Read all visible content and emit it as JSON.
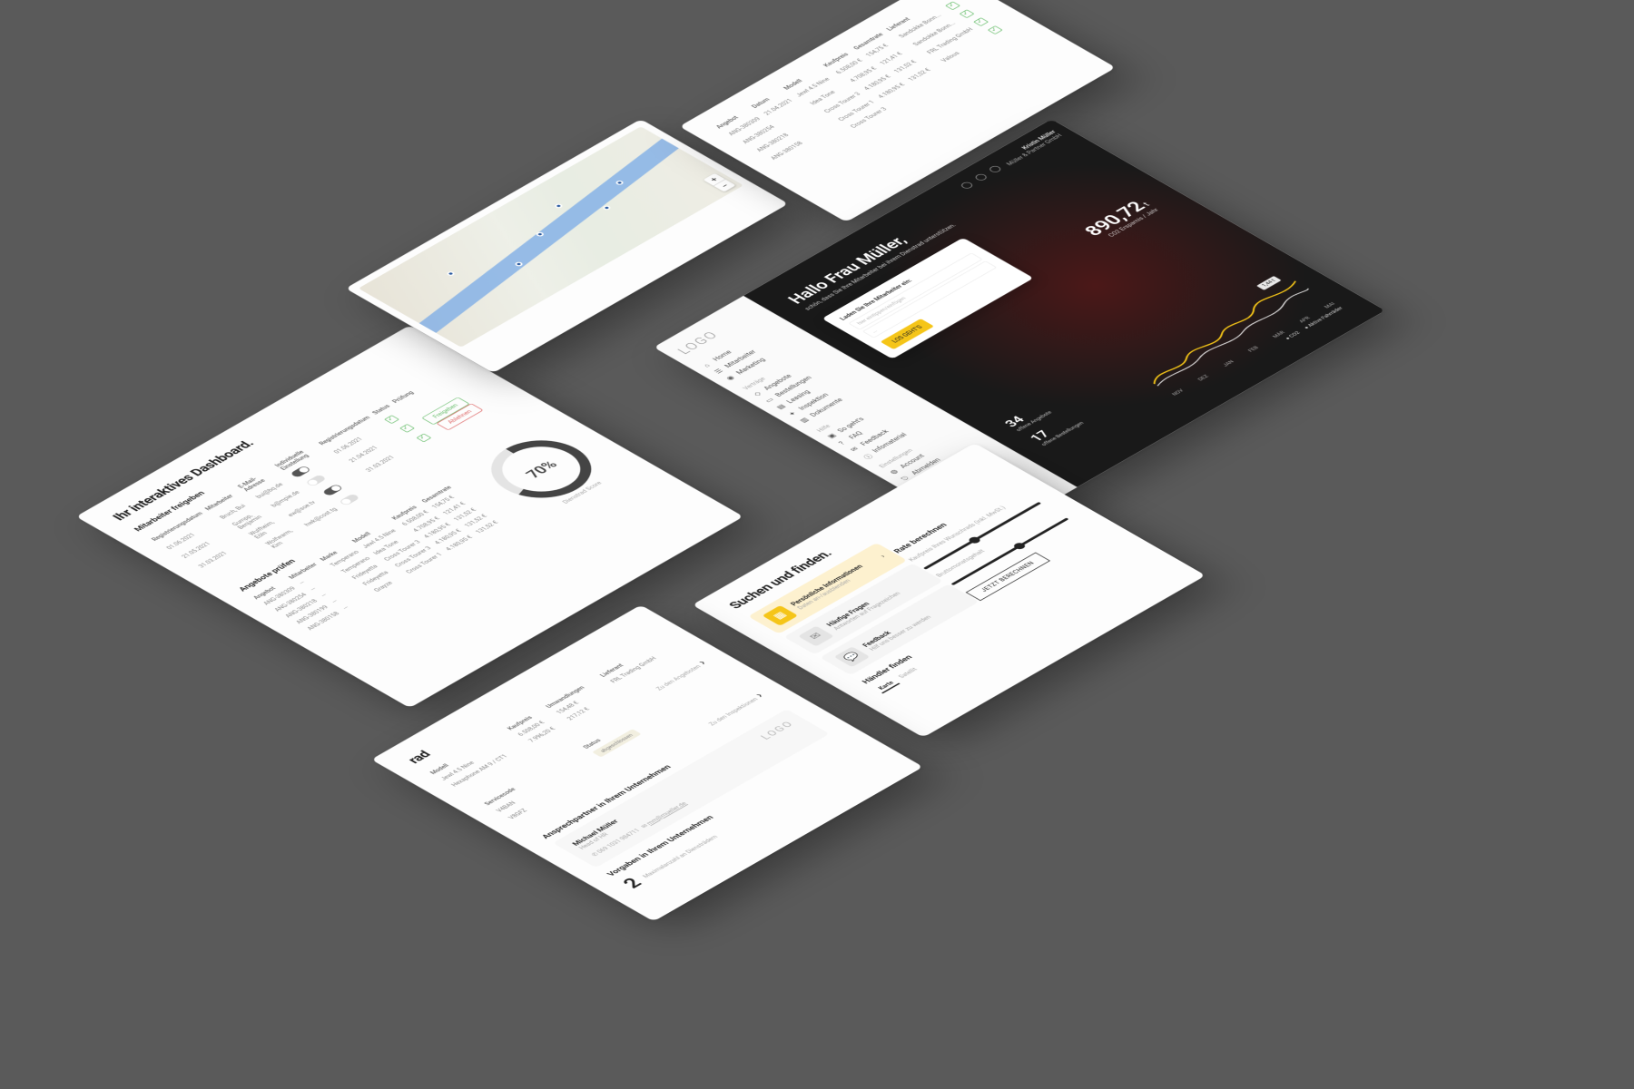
{
  "dashboard": {
    "title": "Ihr interaktives Dashboard.",
    "section_employees": "Mitarbeiter freigeben",
    "employees": {
      "cols": [
        "Registrierungsdatum",
        "Mitarbeiter",
        "E-Mail-Adresse",
        "Individuelle Einstellung",
        "Registrierungsdatum",
        "Status",
        "Prüfung"
      ],
      "rows": [
        {
          "date": "01.06.2021",
          "name": "Bruch, Bui",
          "email": "bui@bq.de",
          "reg": "01.06.2021"
        },
        {
          "date": "21.05.2021",
          "name": "Gumpp, Benjamin",
          "email": "b@mpie.de",
          "reg": "21.04.2021"
        },
        {
          "date": "31.03.2021",
          "name": "Wulfheim, Eöln",
          "email": "ew@soe.tv",
          "reg": "31.03.2021"
        },
        {
          "date": "",
          "name": "Wolfwarm, Kim",
          "email": "hwk@cost.tg",
          "reg": ""
        }
      ],
      "btn_approve": "Freigeben",
      "btn_reject": "Ablehnen"
    },
    "section_offers": "Angebote prüfen",
    "offers": {
      "col_offer": "Angebot",
      "col_employee": "Mitarbeiter",
      "col_brand": "Marke",
      "col_model": "Modell",
      "col_price": "Kaufpreis",
      "col_total": "Gesamtrate",
      "ids": [
        "ANG-380309",
        "ANG-380254",
        "ANG-380218",
        "ANG-380199",
        "ANG-380158"
      ],
      "brands": [
        "Temperano",
        "Temperano",
        "Frideyetta",
        "Frideyetta",
        "Grayze"
      ],
      "models": [
        "Jewl 4.5 Nine",
        "Idea Tone",
        "Cross Tourer 3",
        "Cross Tourer 3",
        "Cross Tourer 1"
      ],
      "prices": [
        "6.508,00 €",
        "4.708,95 €",
        "4.180,95 €",
        "4.180,95 €",
        "4.180,95 €"
      ],
      "totals": [
        "154,75 €",
        "121,41 €",
        "131,52 €",
        "131,52 €",
        "131,52 €"
      ]
    },
    "donut": {
      "value": "70%",
      "label": "Dienstrad Score"
    }
  },
  "mapPanel": {
    "zoom_in": "+",
    "zoom_out": "−"
  },
  "topRight": {
    "col_id": "Angebot",
    "col_date": "Datum",
    "ids": [
      "ANG-380309",
      "ANG-380254",
      "ANG-380218",
      "ANG-380158"
    ],
    "date": "21.04.2021",
    "col_model": "Modell",
    "models": [
      "Jewl 4.5 Nine",
      "Idea Tone",
      "Cross Tourer 3",
      "Cross Tourer 1",
      "Cross Tourer 3"
    ],
    "col_price": "Kaufpreis",
    "prices": [
      "6.508,00 €",
      "4.708,95 €",
      "4.180,95 €",
      "4.180,95 €"
    ],
    "col_total": "Gesamtrate",
    "totals": [
      "154,75 €",
      "121,41 €",
      "131,52 €",
      "131,52 €"
    ],
    "col_supplier": "Lieferant",
    "suppliers": [
      "Sandokke Bonn...",
      "Sandokke Bonn...",
      "FRL Trading GmbH",
      "Valous"
    ]
  },
  "app": {
    "logo": "LOGO",
    "nav": {
      "home": "Home",
      "employees": "Mitarbeiter",
      "marketing": "Marketing"
    },
    "grp_contracts": "Verträge",
    "nav2": {
      "offers": "Angebote",
      "orders": "Bestellungen",
      "leasing": "Leasing",
      "inspection": "Inspektion",
      "documents": "Dokumente"
    },
    "grp_help": "Hilfe",
    "nav3": {
      "howto": "So geht's",
      "faq": "FAQ",
      "feedback": "Feedback",
      "info": "Infomaterial"
    },
    "grp_settings": "Einstellungen",
    "nav4": {
      "account": "Account",
      "logout": "Abmelden"
    },
    "greeting": "Hallo Frau Müller,",
    "subtitle": "schön, dass Sie Ihre Mitarbeiter bei ihrem Dienstrad unterstützen.",
    "invite_title": "Laden Sie Ihre Mitarbeiter ein:",
    "invite_ph1": "hier eintippen/einfügen",
    "invite_ph2": "...",
    "invite_btn": "LOS GEHT'S",
    "stat1_val": "34",
    "stat1_lbl": "offene Angebote",
    "stat2_val": "17",
    "stat2_lbl": "offene Bestellungen",
    "co2_val": "890,72",
    "co2_unit": "t",
    "co2_lbl": "CO2 Ersparnis / Jahr",
    "months": [
      "NOV",
      "DEZ",
      "JAN",
      "FEB",
      "MÄR",
      "APR",
      "MAI"
    ],
    "legend1": "CO2",
    "legend2": "Aktive Fahrräder",
    "peak": "1,44 t",
    "user_name": "Kristin Müller",
    "user_company": "Müller & Partner GmbH"
  },
  "search": {
    "title": "Suchen und finden.",
    "card1_title": "Persönliche Informationen",
    "card1_sub": "Daten an-/ausblenden",
    "card2_title": "Häufige Fragen",
    "card2_sub": "Antworten auf Fragezeichen",
    "card3_title": "Feedback",
    "card3_sub": "Hilf uns besser zu werden",
    "dealer_title": "Händler finden",
    "tab_map": "Karte",
    "tab_sat": "Satellit",
    "rate_title": "Rate berechnen",
    "slider1": "Kaufpreis Ihres Wunschrads (inkl. MwSt.)",
    "slider2": "Bruttomonatsgehalt",
    "btn_calc": "JETZT BERECHNEN"
  },
  "bottomLeft": {
    "hdr_frag": "rad",
    "col_model": "Modell",
    "col_price": "Kaufpreis",
    "col_vnr": "Umwandlungen",
    "col_supplier": "Lieferant",
    "models": [
      "Jewl 4.5 Nine",
      "Hexaphone AM 9 / CT1"
    ],
    "prices": [
      "6.508,00 €",
      "7.996,20 €"
    ],
    "vnr": [
      "154,48 €",
      "217,12 €"
    ],
    "supplier": "FRL Trading GmbH",
    "link_offers": "Zu den Angeboten",
    "svc_col": "Servicecode",
    "svc_codes": [
      "V4BAN",
      "V8GFZ"
    ],
    "status_col": "Status",
    "status_val": "abgeschlossen",
    "link_insp": "Zu den Inspektionen",
    "contact_title": "Ansprechpartner in Ihrem Unternehmen",
    "contact_name": "Michael Müller",
    "contact_role": "Head of HR",
    "contact_phone": "069 1031 984711",
    "contact_email": "mm@mueller.de",
    "contact_logo": "LOGO",
    "rules_title": "Vorgaben in Ihrem Unternehmen",
    "rules_val": "2",
    "rules_lbl": "Maximalanzahl an Diensträdern"
  }
}
